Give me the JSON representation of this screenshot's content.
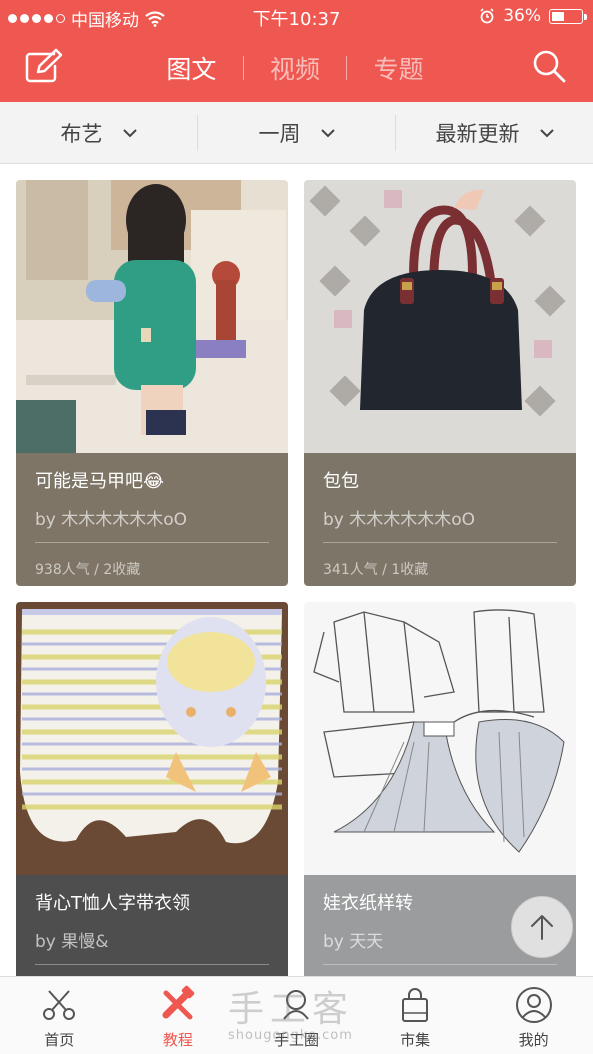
{
  "status_bar": {
    "carrier": "中国移动",
    "time": "下午10:37",
    "battery": "36%",
    "battery_level": 0.36
  },
  "header": {
    "tabs": [
      {
        "label": "图文",
        "active": true
      },
      {
        "label": "视频",
        "active": false
      },
      {
        "label": "专题",
        "active": false
      }
    ],
    "accent_color": "#ef5850"
  },
  "filters": [
    {
      "label": "布艺"
    },
    {
      "label": "一周"
    },
    {
      "label": "最新更新"
    }
  ],
  "cards": [
    {
      "title": "可能是马甲吧😂",
      "author": "by 木木木木木木oO",
      "stats": "938人气 / 2收藏",
      "info_color": "#7e7566"
    },
    {
      "title": "包包",
      "author": "by 木木木木木木oO",
      "stats": "341人气 / 1收藏",
      "info_color": "#7d7668"
    },
    {
      "title": "背心T恤人字带衣领",
      "author": "by 果慢&",
      "stats": "",
      "info_color": "#4e4e4e"
    },
    {
      "title": "娃衣纸样转",
      "author": "by 天天",
      "stats": "",
      "info_color": "#9a9c9d"
    }
  ],
  "bottom_nav": [
    {
      "label": "首页",
      "icon": "scissors-icon",
      "active": false
    },
    {
      "label": "教程",
      "icon": "tools-icon",
      "active": true
    },
    {
      "label": "手工圈",
      "icon": "circle-icon",
      "active": false
    },
    {
      "label": "市集",
      "icon": "shopping-bag-icon",
      "active": false
    },
    {
      "label": "我的",
      "icon": "user-icon",
      "active": false
    }
  ],
  "watermark": {
    "main": "手工客",
    "sub": "shougongke.com"
  }
}
